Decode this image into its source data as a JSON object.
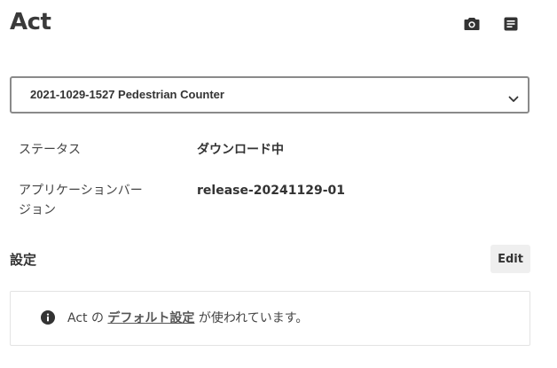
{
  "header": {
    "title": "Act",
    "icons": [
      "camera-icon",
      "notes-icon"
    ]
  },
  "select": {
    "value": "2021-1029-1527 Pedestrian Counter",
    "icon": "chevron-down-icon"
  },
  "details": {
    "status_label": "ステータス",
    "status_value": "ダウンロード中",
    "version_label": "アプリケーションバージョン",
    "version_value": "release-20241129-01"
  },
  "settings": {
    "title": "設定",
    "edit_label": "Edit",
    "info_prefix": "Act の",
    "info_link": "デフォルト設定",
    "info_suffix": "が使われています。",
    "info_icon": "info-icon"
  },
  "colors": {
    "text": "#333333",
    "border": "#8a8a8a",
    "button_bg": "#efefef"
  }
}
